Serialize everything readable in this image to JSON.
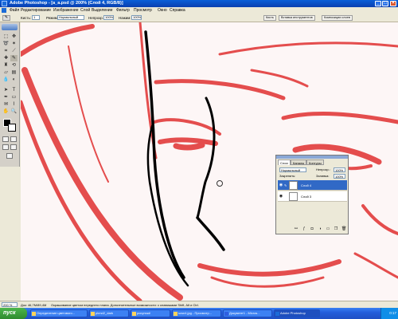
{
  "window": {
    "title": "Adobe Photoshop - [a_a.psd @ 200% (Слой 4, RGB/8)]",
    "minimize": "_",
    "maximize": "□",
    "close": "×"
  },
  "menu": {
    "items": [
      "Файл",
      "Редактирование",
      "Изображение",
      "Слой",
      "Выделение",
      "Фильтр",
      "Просмотр",
      "Окно",
      "Справка"
    ]
  },
  "options": {
    "brush_label": "Кисть:",
    "brush_size": "1",
    "mode_label": "Режим:",
    "mode_value": "Нормальный",
    "opacity_label": "Непрозр.:",
    "opacity_value": "100%",
    "flow_label": "Нажим:",
    "flow_value": "100%",
    "palette_tabs": [
      "Кисть",
      "Вставка инструментов",
      "Композиции слоев"
    ]
  },
  "layers_panel": {
    "tabs": [
      "Слои",
      "Каналы",
      "Контуры"
    ],
    "blend_mode": "Нормальный",
    "opacity_label": "Непрозр.:",
    "opacity_value": "100%",
    "lock_label": "Закрепить:",
    "fill_label": "Заливка:",
    "fill_value": "100%",
    "layers": [
      {
        "name": "Слой 4",
        "active": true
      },
      {
        "name": "Слой 3",
        "active": false
      }
    ]
  },
  "status": {
    "zoom": "200 %",
    "doc": "Док: 46,7M/89,4M",
    "hint": "Окрашивание цветом переднего плана. Дополнительные возможности: с клавишами Shift, Alt и Ctrl."
  },
  "taskbar": {
    "start": "пуск",
    "buttons": [
      {
        "label": "Определение цветового...",
        "active": false
      },
      {
        "label": "pkmd2_dark",
        "active": false
      },
      {
        "label": "риcунок#",
        "active": false
      },
      {
        "label": "scsn4.jpg - Просмотр...",
        "active": false
      },
      {
        "label": "Документ1 - Micros...",
        "active": false
      },
      {
        "label": "Adobe Photoshop",
        "active": true
      }
    ],
    "clock": "0:17"
  },
  "colors": {
    "titlebar": "#0a4fc8",
    "sketch_red": "#e03030",
    "stroke_black": "#000000",
    "layer_selected": "#3169c6"
  }
}
